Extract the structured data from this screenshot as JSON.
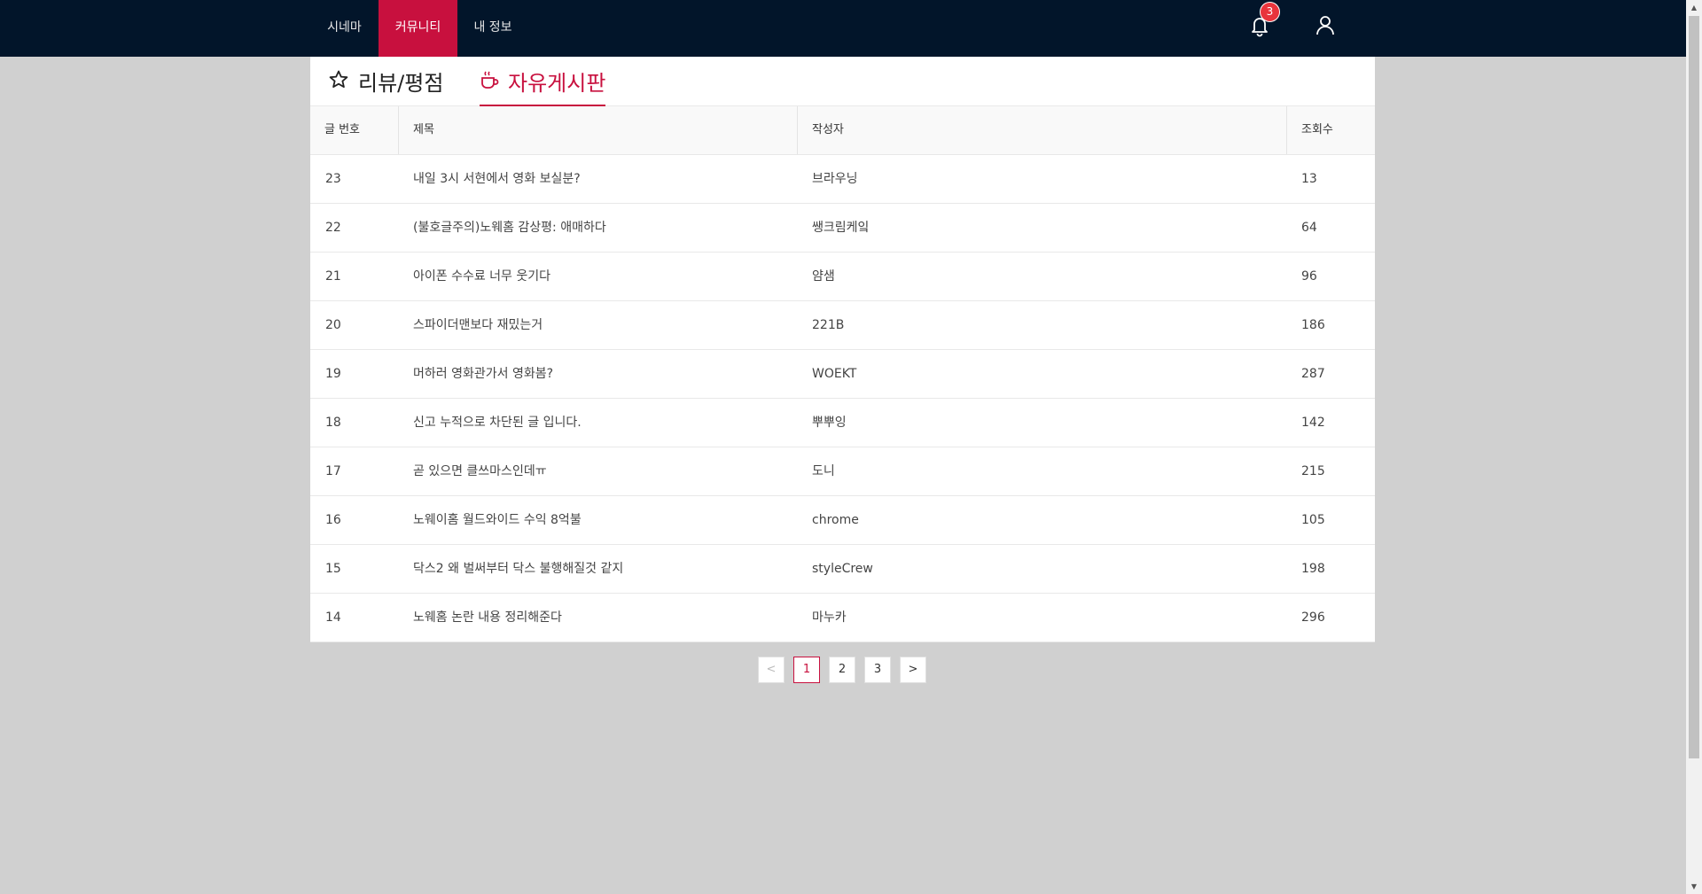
{
  "nav": {
    "items": [
      {
        "label": "시네마"
      },
      {
        "label": "커뮤니티"
      },
      {
        "label": "내 정보"
      }
    ],
    "active_index": 1,
    "notification_count": "3"
  },
  "colors": {
    "nav_bg": "#02152a",
    "accent": "#c8103e",
    "badge": "#e8343c",
    "page_bg": "#d0d0d0"
  },
  "tabs": [
    {
      "label": "리뷰/평점",
      "icon": "star-icon"
    },
    {
      "label": "자유게시판",
      "icon": "coffee-cup-icon"
    }
  ],
  "active_tab": 1,
  "table": {
    "headers": [
      "글 번호",
      "제목",
      "작성자",
      "조회수"
    ],
    "rows": [
      {
        "no": "23",
        "title": "내일 3시 서현에서 영화 보실분?",
        "author": "브라우닝",
        "views": "13"
      },
      {
        "no": "22",
        "title": "(불호글주의)노웨홈 감상평: 애매하다",
        "author": "쌩크림케잌",
        "views": "64"
      },
      {
        "no": "21",
        "title": "아이폰 수수료 너무 웃기다",
        "author": "얌샘",
        "views": "96"
      },
      {
        "no": "20",
        "title": "스파이더맨보다 재밌는거",
        "author": "221B",
        "views": "186"
      },
      {
        "no": "19",
        "title": "머하러 영화관가서 영화봄?",
        "author": "WOEKT",
        "views": "287"
      },
      {
        "no": "18",
        "title": "신고 누적으로 차단된 글 입니다.",
        "author": "뿌뿌잉",
        "views": "142"
      },
      {
        "no": "17",
        "title": "곧 있으면 클쓰마스인데ㅠ",
        "author": "도니",
        "views": "215"
      },
      {
        "no": "16",
        "title": "노웨이홈 월드와이드 수익 8억불",
        "author": "chrome",
        "views": "105"
      },
      {
        "no": "15",
        "title": "닥스2 왜 벌써부터 닥스 불행해질것 같지",
        "author": "styleCrew",
        "views": "198"
      },
      {
        "no": "14",
        "title": "노웨홈 논란 내용 정리해준다",
        "author": "마누카",
        "views": "296"
      }
    ]
  },
  "pagination": {
    "prev": "<",
    "pages": [
      "1",
      "2",
      "3"
    ],
    "current": "1",
    "next": ">"
  }
}
